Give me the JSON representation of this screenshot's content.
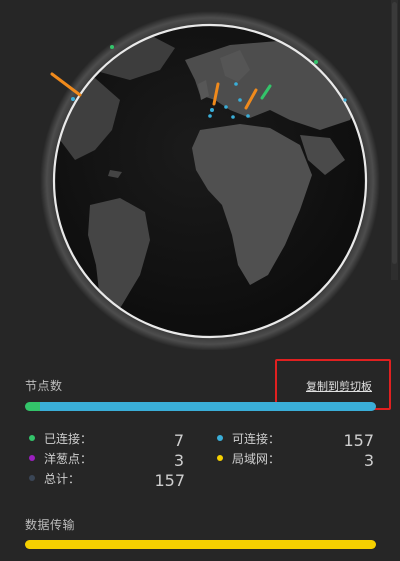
{
  "nodes": {
    "title": "节点数",
    "copy_label": "复制到剪切板",
    "bar_segments": [
      {
        "name": "connected",
        "value": 7,
        "color": "#33c46a"
      },
      {
        "name": "connectable",
        "value": 157,
        "color": "#3aaed8"
      }
    ],
    "legend": [
      {
        "label": "已连接：",
        "value": "7",
        "color": "#33c46a"
      },
      {
        "label": "可连接：",
        "value": "157",
        "color": "#3aaed8"
      },
      {
        "label": "洋葱点：",
        "value": "3",
        "color": "#9b1fbf"
      },
      {
        "label": "局域网：",
        "value": "3",
        "color": "#f5d000"
      },
      {
        "label": "总计：",
        "value": "157",
        "color": "#3a4656"
      }
    ]
  },
  "transfer": {
    "title": "数据传输",
    "bar_color": "#f5d000",
    "fraction": 1.0
  }
}
